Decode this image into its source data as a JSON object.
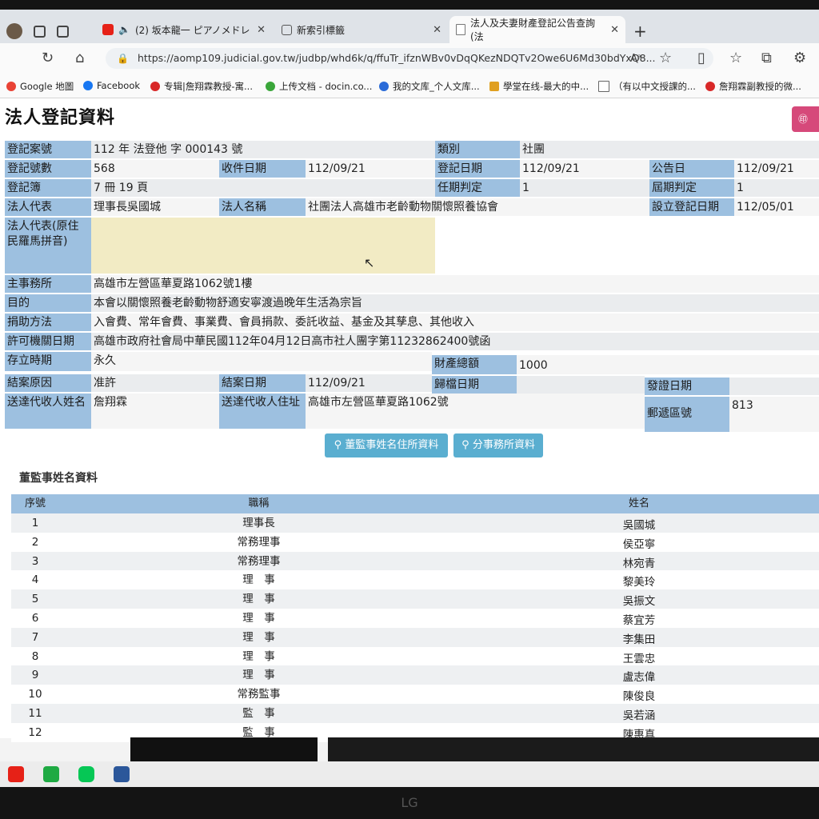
{
  "browser": {
    "tabs": [
      {
        "label": "(2) 坂本龍一 ピアノメドレ"
      },
      {
        "label": "新索引標籤"
      },
      {
        "label": "法人及夫妻財產登記公告查詢(法"
      }
    ],
    "url": "https://aomp109.judicial.gov.tw/judbp/whd6k/q/ffuTr_ifznWBv0vDqQKezNDQTv2Owe6U6Md30bdYxQ8...",
    "reader_label": "A",
    "bookmarks": [
      "Google 地圖",
      "Facebook",
      "专辑|詹翔霖教授-寓...",
      "上传文档 - docin.co...",
      "我的文库_个人文库...",
      "學堂在线-最大的中...",
      "（有以中文授課的...",
      "詹翔霖副教授的微..."
    ]
  },
  "page": {
    "title": "法人登記資料",
    "print_label": "㊞",
    "fields": {
      "case_no_label": "登記案號",
      "case_no": "112 年  法登他 字  000143 號",
      "category_label": "類別",
      "category": "社團",
      "reg_count_label": "登記號數",
      "reg_count": "568",
      "receipt_date_label": "收件日期",
      "receipt_date": "112/09/21",
      "reg_date_label": "登記日期",
      "reg_date": "112/09/21",
      "announce_date_label": "公告日",
      "announce_date": "112/09/21",
      "book_label": "登記簿",
      "book": "7 冊  19 頁",
      "term_label": "任期判定",
      "term": "1",
      "session_label": "屆期判定",
      "session": "1",
      "rep_label": "法人代表",
      "rep": "理事長吳國城",
      "name_label": "法人名稱",
      "name": "社團法人高雄市老齡動物關懷照養協會",
      "est_date_label": "設立登記日期",
      "est_date": "112/05/01",
      "rep_aboriginal_label": "法人代表(原住民羅馬拼音)",
      "office_label": "主事務所",
      "office": "高雄市左營區華夏路1062號1樓",
      "purpose_label": "目的",
      "purpose": "本會以關懷照養老齡動物舒適安寧渡過晚年生活為宗旨",
      "funding_label": "捐助方法",
      "funding": "入會費、常年會費、事業費、會員捐款、委託收益、基金及其孳息、其他收入",
      "permit_label": "許可機關日期",
      "permit": "高雄市政府社會局中華民國112年04月12日高市社人團字第11232862400號函",
      "duration_label": "存立時期",
      "duration": "永久",
      "assets_label": "財產總額",
      "assets": "1000",
      "close_reason_label": "結案原因",
      "close_reason": "准許",
      "close_date_label": "結案日期",
      "close_date": "112/09/21",
      "archive_date_label": "歸檔日期",
      "archive_date": "",
      "issue_date_label": "發證日期",
      "issue_date": "",
      "agent_name_label": "送達代收人姓名",
      "agent_name": "詹翔霖",
      "agent_addr_label": "送達代收人住址",
      "agent_addr": "高雄市左營區華夏路1062號",
      "zip_label": "郵遞區號",
      "zip": "813"
    },
    "buttons": {
      "directors": "董監事姓名住所資料",
      "branch": "分事務所資料"
    },
    "directors_section": "董監事姓名資料",
    "table_headers": {
      "no": "序號",
      "title": "職稱",
      "name": "姓名"
    },
    "directors": [
      {
        "no": "1",
        "title": "理事長",
        "name": "吳國城"
      },
      {
        "no": "2",
        "title": "常務理事",
        "name": "侯亞寧"
      },
      {
        "no": "3",
        "title": "常務理事",
        "name": "林宛青"
      },
      {
        "no": "4",
        "title": "理　事",
        "name": "黎美玲"
      },
      {
        "no": "5",
        "title": "理　事",
        "name": "吳振文"
      },
      {
        "no": "6",
        "title": "理　事",
        "name": "蔡宜芳"
      },
      {
        "no": "7",
        "title": "理　事",
        "name": "李集田"
      },
      {
        "no": "8",
        "title": "理　事",
        "name": "王雲忠"
      },
      {
        "no": "9",
        "title": "理　事",
        "name": "盧志偉"
      },
      {
        "no": "10",
        "title": "常務監事",
        "name": "陳俊良"
      },
      {
        "no": "11",
        "title": "監　事",
        "name": "吳若涵"
      },
      {
        "no": "12",
        "title": "監　事",
        "name": "陳惠真"
      }
    ]
  },
  "colors": {
    "label_bg": "#9dc0e0",
    "button_bg": "#5aaed0",
    "print_bg": "#d6497a"
  },
  "monitor_brand": "LG"
}
